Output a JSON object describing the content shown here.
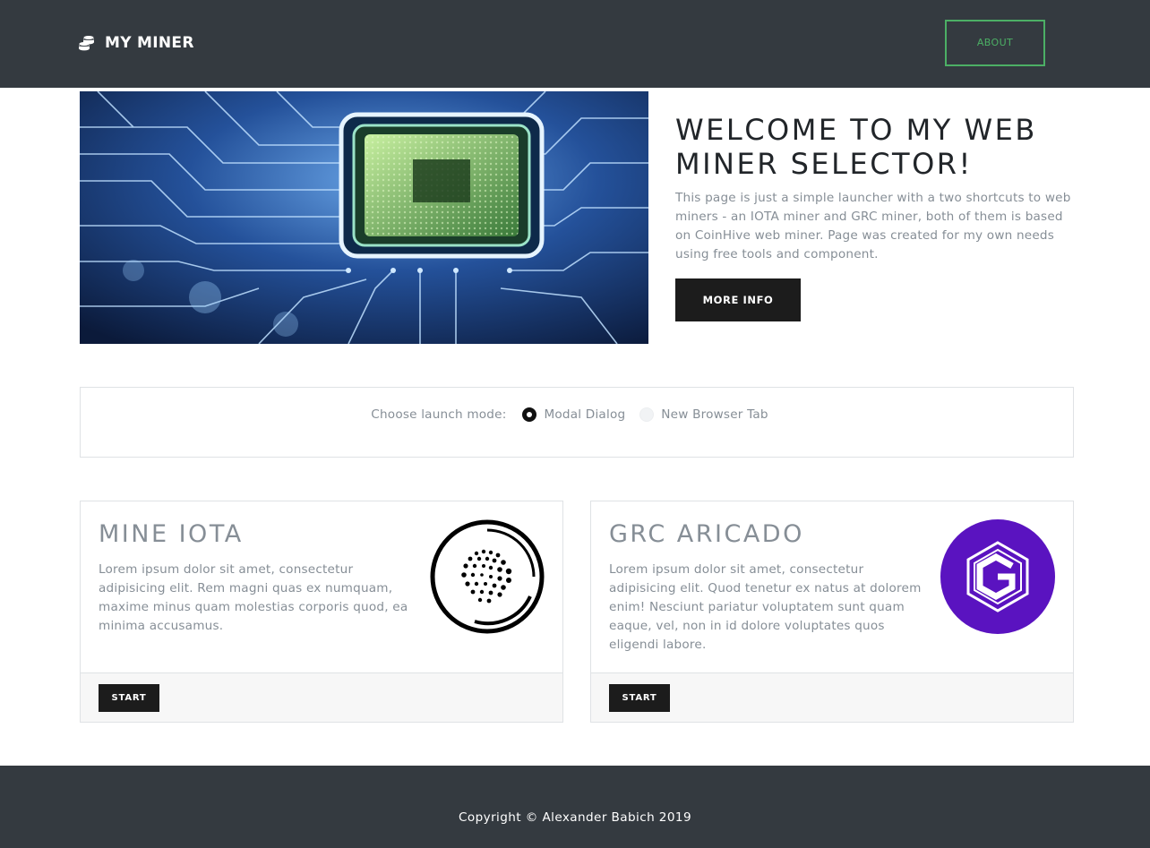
{
  "navbar": {
    "brand": "MY MINER",
    "brand_icon": "coins-icon",
    "about_label": "ABOUT",
    "bg_color": "#343a40",
    "accent_color": "#4caf65"
  },
  "hero": {
    "image_icon": "circuit-board-chip-image",
    "title": "WELCOME TO MY WEB MINER SELECTOR!",
    "description": "This page is just a simple launcher with a two shortcuts to web miners - an IOTA miner and GRC miner, both of them is based on CoinHive web miner. Page was created for my own needs using free tools and component.",
    "more_info_label": "MORE INFO"
  },
  "launch_mode": {
    "label": "Choose launch mode:",
    "options": [
      {
        "label": "Modal Dialog",
        "selected": true
      },
      {
        "label": "New Browser Tab",
        "selected": false
      }
    ]
  },
  "cards": [
    {
      "title": "MINE IOTA",
      "text": "Lorem ipsum dolor sit amet, consectetur adipisicing elit. Rem magni quas ex numquam, maxime minus quam molestias corporis quod, ea minima accusamus.",
      "logo_icon": "iota-logo-icon",
      "start_label": "START"
    },
    {
      "title": "GRC ARICADO",
      "text": "Lorem ipsum dolor sit amet, consectetur adipisicing elit. Quod tenetur ex natus at dolorem enim! Nesciunt pariatur voluptatem sunt quam eaque, vel, non in id dolore voluptates quos eligendi labore.",
      "logo_icon": "gridcoin-logo-icon",
      "logo_color": "#5a13c0",
      "start_label": "START"
    }
  ],
  "footer": {
    "copyright": "Copyright © Alexander Babich 2019"
  }
}
